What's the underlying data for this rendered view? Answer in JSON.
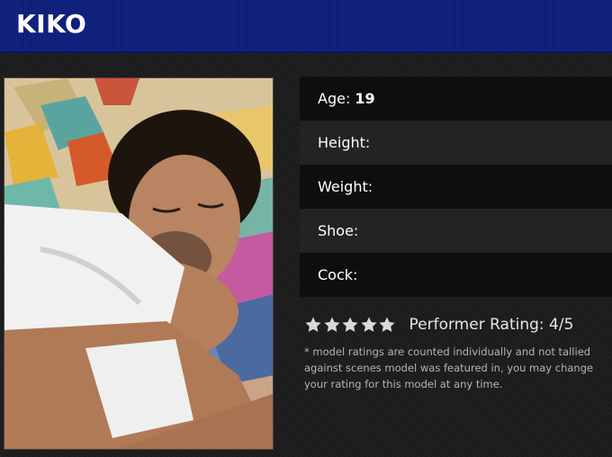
{
  "header": {
    "title": "KIKO"
  },
  "photo": {
    "alt": "model photo"
  },
  "stats": [
    {
      "label": "Age:",
      "value": "19"
    },
    {
      "label": "Height:",
      "value": ""
    },
    {
      "label": "Weight:",
      "value": ""
    },
    {
      "label": "Shoe:",
      "value": ""
    },
    {
      "label": "Cock:",
      "value": ""
    }
  ],
  "rating": {
    "stars_filled": 5,
    "stars_total": 5,
    "label": "Performer Rating: 4/5",
    "star_color": "#d9d9d9"
  },
  "note": "* model ratings are counted individually and not tallied against scenes model was featured in, you may change your rating for this model at any time.",
  "colors": {
    "header_bg": "#0f1e7a",
    "page_bg": "#1c1c1c"
  }
}
